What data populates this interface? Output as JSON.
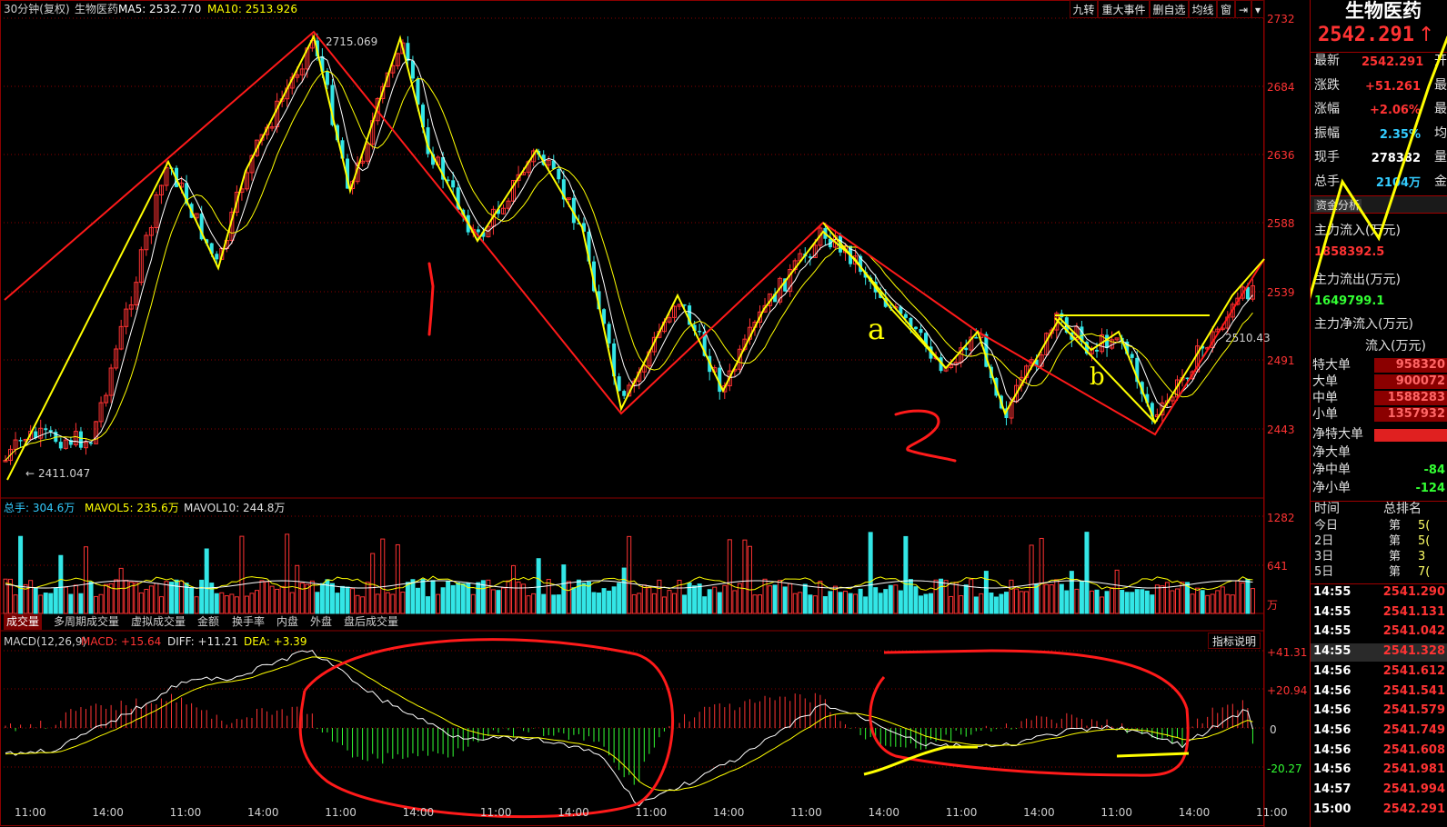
{
  "header": {
    "period": "30分钟(复权)",
    "name": "生物医药",
    "ma5_label": "MA5: 2532.770",
    "ma10_label": "MA10: 2513.926"
  },
  "toolbar": [
    "九转",
    "重大事件",
    "删自选",
    "均线",
    "窗"
  ],
  "price_axis": [
    "2732",
    "2684",
    "2636",
    "2588",
    "2539",
    "2491",
    "2443"
  ],
  "labels": {
    "high_price": "2715.069",
    "low_price": "2411.047",
    "last_price": "2510.43"
  },
  "volume_header": {
    "total": "总手: 304.6万",
    "mavol5": "MAVOL5: 235.6万",
    "mavol10": "MAVOL10: 244.8万"
  },
  "volume_axis": [
    "1282",
    "641",
    "万"
  ],
  "bottom_tabs": [
    "成交量",
    "多周期成交量",
    "虚拟成交量",
    "金额",
    "换手率",
    "内盘",
    "外盘",
    "盘后成交量"
  ],
  "macd_header": {
    "title": "MACD(12,26,9)",
    "macd": "MACD: +15.64",
    "diff": "DIFF: +11.21",
    "dea": "DEA: +3.39",
    "explain": "指标说明"
  },
  "macd_axis": [
    "+41.31",
    "+20.94",
    "0",
    "-20.27"
  ],
  "time_axis": [
    "11:00",
    "14:00",
    "11:00",
    "14:00",
    "11:00",
    "14:00",
    "11:00",
    "14:00",
    "11:00",
    "14:00",
    "11:00",
    "14:00",
    "11:00",
    "14:00",
    "11:00",
    "14:00",
    "11:00"
  ],
  "annotations": {
    "wave_1": "1",
    "wave_2": "2",
    "wave_a": "a",
    "wave_b": "b"
  },
  "panel": {
    "title": "生物医药",
    "price": "2542.291",
    "rows": [
      {
        "label": "最新",
        "value": "2542.291",
        "extra": "开"
      },
      {
        "label": "涨跌",
        "value": "+51.261",
        "extra": "最"
      },
      {
        "label": "涨幅",
        "value": "+2.06%",
        "extra": "最"
      },
      {
        "label": "振幅",
        "value": "2.35%",
        "extra": "均"
      },
      {
        "label": "现手",
        "value": "278382",
        "extra": "量"
      },
      {
        "label": "总手",
        "value": "2104万",
        "extra": "金"
      }
    ],
    "fund_tab": "资金分析",
    "main_in_label": "主力流入(万元)",
    "main_in_value": "1858392.5",
    "main_out_label": "主力流出(万元)",
    "main_out_value": "1649799.1",
    "main_net_label": "主力净流入(万元)",
    "inflow_header": "流入(万元)",
    "orders": [
      {
        "label": "特大单",
        "value": "958320"
      },
      {
        "label": "大单",
        "value": "900072"
      },
      {
        "label": "中单",
        "value": "1588283"
      },
      {
        "label": "小单",
        "value": "1357932"
      }
    ],
    "net": [
      {
        "label": "净特大单",
        "value": ""
      },
      {
        "label": "净大单",
        "value": ""
      },
      {
        "label": "净中单",
        "value": "-84"
      },
      {
        "label": "净小单",
        "value": "-124"
      }
    ],
    "rank_header_left": "时间",
    "rank_header_right": "总排名",
    "rank": [
      {
        "label": "今日",
        "mid": "第",
        "value": "5("
      },
      {
        "label": "2日",
        "mid": "第",
        "value": "5("
      },
      {
        "label": "3日",
        "mid": "第",
        "value": "3"
      },
      {
        "label": "5日",
        "mid": "第",
        "value": "7("
      }
    ],
    "ticks": [
      {
        "time": "14:55",
        "price": "2541.290"
      },
      {
        "time": "14:55",
        "price": "2541.131"
      },
      {
        "time": "14:55",
        "price": "2541.042"
      },
      {
        "time": "14:55",
        "price": "2541.328"
      },
      {
        "time": "14:56",
        "price": "2541.612"
      },
      {
        "time": "14:56",
        "price": "2541.541"
      },
      {
        "time": "14:56",
        "price": "2541.579"
      },
      {
        "time": "14:56",
        "price": "2541.749"
      },
      {
        "time": "14:56",
        "price": "2541.608"
      },
      {
        "time": "14:56",
        "price": "2541.981"
      },
      {
        "time": "14:57",
        "price": "2541.994"
      },
      {
        "time": "15:00",
        "price": "2542.291"
      }
    ]
  },
  "colors": {
    "up": "#ff3333",
    "down": "#33e6e6",
    "ma5": "#ffffff",
    "ma10": "#ffff00",
    "grid": "#8b0000",
    "drawing_red": "#ff1a1a",
    "drawing_yellow": "#ffff00"
  }
}
